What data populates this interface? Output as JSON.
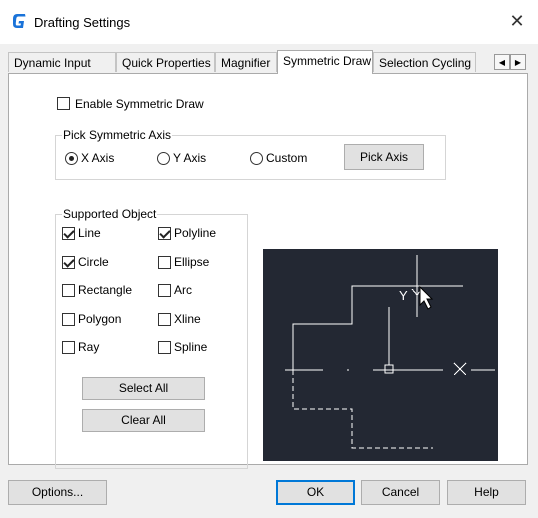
{
  "window": {
    "title": "Drafting Settings",
    "close_glyph": "✕"
  },
  "tabs": [
    {
      "label": "Dynamic Input"
    },
    {
      "label": "Quick Properties"
    },
    {
      "label": "Magnifier"
    },
    {
      "label": "Symmetric Draw",
      "active": true
    },
    {
      "label": "Selection Cycling"
    }
  ],
  "tab_scroll": {
    "left": "◀",
    "right": "▶"
  },
  "enable_symmetric": {
    "label": "Enable Symmetric Draw",
    "checked": false
  },
  "pick_axis": {
    "title": "Pick Symmetric Axis",
    "options": [
      {
        "label": "X Axis",
        "checked": true
      },
      {
        "label": "Y Axis",
        "checked": false
      },
      {
        "label": "Custom",
        "checked": false
      }
    ],
    "button": "Pick Axis"
  },
  "supported": {
    "title": "Supported Object",
    "items": [
      {
        "label": "Line",
        "checked": true
      },
      {
        "label": "Polyline",
        "checked": true
      },
      {
        "label": "Circle",
        "checked": true
      },
      {
        "label": "Ellipse",
        "checked": false
      },
      {
        "label": "Rectangle",
        "checked": false
      },
      {
        "label": "Arc",
        "checked": false
      },
      {
        "label": "Polygon",
        "checked": false
      },
      {
        "label": "Xline",
        "checked": false
      },
      {
        "label": "Ray",
        "checked": false
      },
      {
        "label": "Spline",
        "checked": false
      }
    ],
    "select_all": "Select All",
    "clear_all": "Clear All"
  },
  "preview": {
    "y_label": "Y",
    "colors": {
      "bg": "#232833",
      "line": "#ffffff"
    }
  },
  "footer": {
    "options": "Options...",
    "ok": "OK",
    "cancel": "Cancel",
    "help": "Help"
  },
  "colors": {
    "icon_blue": "#1a73d9",
    "default_border": "#0078d7"
  }
}
